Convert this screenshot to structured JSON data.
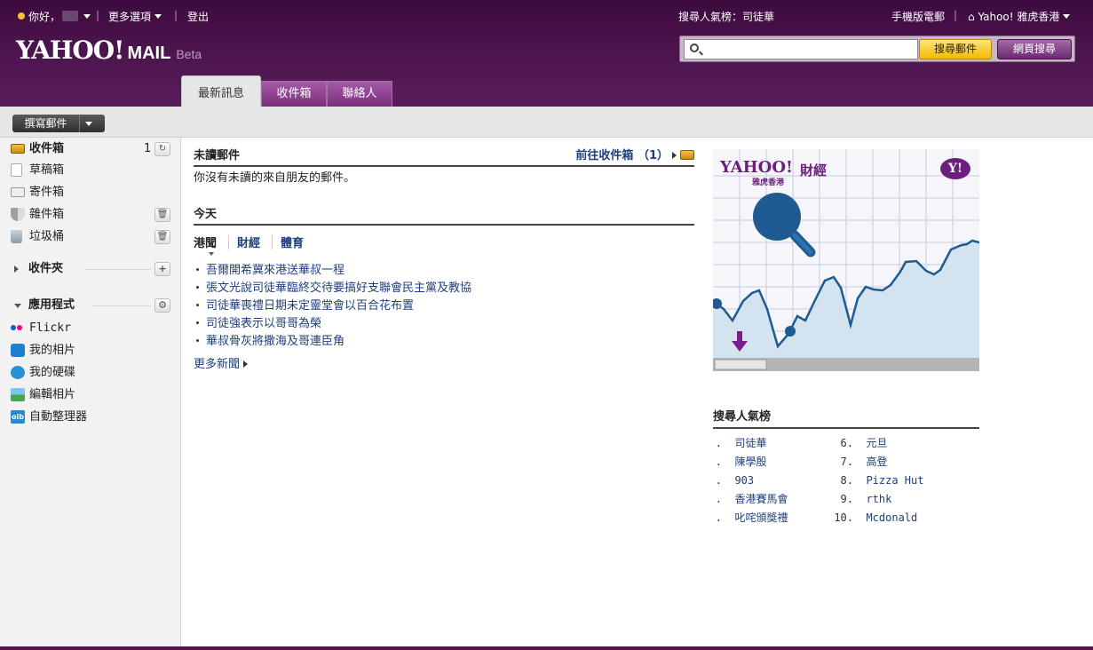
{
  "header": {
    "greeting": "你好，",
    "more_options": "更多選項",
    "logout": "登出",
    "popular_search_label": "搜尋人氣榜：司徒華",
    "mobile_mail": "手機版電郵",
    "yahoo_hk": "Yahoo! 雅虎香港",
    "logo_text": "YAHOO!",
    "logo_mail": "MAIL",
    "logo_beta": "Beta",
    "search_placeholder": "",
    "search_mail_btn": "搜尋郵件",
    "search_web_btn": "網頁搜尋"
  },
  "tabs": [
    {
      "label": "最新訊息",
      "active": true
    },
    {
      "label": "收件箱",
      "active": false
    },
    {
      "label": "聯絡人",
      "active": false
    }
  ],
  "toolbar": {
    "compose_label": "撰寫郵件"
  },
  "sidebar": {
    "folders": [
      {
        "label": "收件箱",
        "count": "1",
        "icon": "inbox-icon"
      },
      {
        "label": "草稿箱",
        "icon": "drafts-icon"
      },
      {
        "label": "寄件箱",
        "icon": "sent-icon"
      },
      {
        "label": "雜件箱",
        "icon": "spam-shield-icon"
      },
      {
        "label": "垃圾桶",
        "icon": "trash-icon"
      }
    ],
    "folders_section": "收件夾",
    "apps_section": "應用程式",
    "apps": [
      {
        "label": "Flickr",
        "icon": "flickr-icon"
      },
      {
        "label": "我的相片",
        "icon": "camera-icon"
      },
      {
        "label": "我的硬碟",
        "icon": "drive-icon"
      },
      {
        "label": "編輯相片",
        "icon": "photo-edit-icon"
      },
      {
        "label": "自動整理器",
        "icon": "organizer-icon"
      }
    ]
  },
  "main": {
    "unread_title": "未讀郵件",
    "goto_inbox": "前往收件箱 （1）",
    "unread_msg": "你沒有未讀的來自朋友的郵件。",
    "today_title": "今天",
    "news_tabs": [
      "港聞",
      "財經",
      "體育"
    ],
    "news": [
      "吾爾開希冀來港送華叔一程",
      "張文光說司徒華臨終交待要搞好支聯會民主黨及教協",
      "司徒華喪禮日期未定靈堂會以百合花布置",
      "司徒強表示以哥哥為榮",
      "華叔骨灰將撒海及哥連臣角"
    ],
    "more_news": "更多新聞"
  },
  "ad": {
    "brand": "YAHOO!",
    "brand_sub": "雅虎香港",
    "section": "財經",
    "corner_logo": "Y!",
    "accent": "#6b1f7c",
    "chart_color": "#1f5a93"
  },
  "trends": {
    "title": "搜尋人氣榜",
    "left": [
      {
        "num": ".",
        "text": "司徒華"
      },
      {
        "num": ".",
        "text": "陳學殷"
      },
      {
        "num": ".",
        "text": "903"
      },
      {
        "num": ".",
        "text": "香港賽馬會"
      },
      {
        "num": ".",
        "text": "叱咤頒獎禮"
      }
    ],
    "right": [
      {
        "num": "6.",
        "text": "元旦"
      },
      {
        "num": "7.",
        "text": "高登"
      },
      {
        "num": "8.",
        "text": "Pizza Hut"
      },
      {
        "num": "9.",
        "text": "rthk"
      },
      {
        "num": "10.",
        "text": "Mcdonald"
      }
    ]
  }
}
